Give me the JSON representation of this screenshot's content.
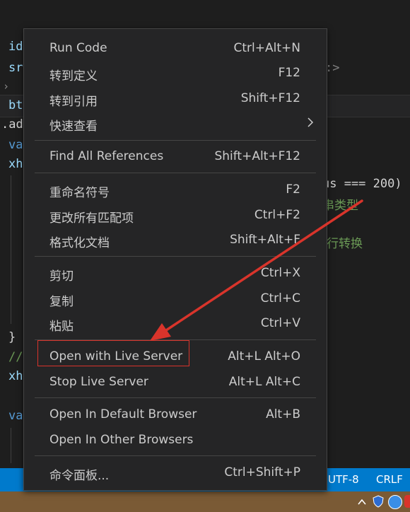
{
  "editor": {
    "fragments": [
      "id",
      "sr",
      "bt",
      ".ad",
      "va",
      "xh",
      "}",
      "//",
      "xh",
      "va"
    ],
    "right_code": {
      "status_compare": "us === 200)",
      "comment1": "串类型",
      "comment2": "行转换",
      "tag_close": ":>"
    }
  },
  "context_menu": {
    "items": [
      {
        "label": "Run Code",
        "shortcut": "Ctrl+Alt+N"
      },
      {
        "label": "转到定义",
        "shortcut": "F12"
      },
      {
        "label": "转到引用",
        "shortcut": "Shift+F12"
      },
      {
        "label": "快速查看",
        "shortcut": ""
      },
      {
        "label": "Find All References",
        "shortcut": "Shift+Alt+F12"
      },
      {
        "label": "重命名符号",
        "shortcut": "F2"
      },
      {
        "label": "更改所有匹配项",
        "shortcut": "Ctrl+F2"
      },
      {
        "label": "格式化文档",
        "shortcut": "Shift+Alt+F"
      },
      {
        "label": "剪切",
        "shortcut": "Ctrl+X"
      },
      {
        "label": "复制",
        "shortcut": "Ctrl+C"
      },
      {
        "label": "粘贴",
        "shortcut": "Ctrl+V"
      },
      {
        "label": "Open with Live Server",
        "shortcut": "Alt+L Alt+O"
      },
      {
        "label": "Stop Live Server",
        "shortcut": "Alt+L Alt+C"
      },
      {
        "label": "Open In Default Browser",
        "shortcut": "Alt+B"
      },
      {
        "label": "Open In Other Browsers",
        "shortcut": ""
      },
      {
        "label": "命令面板...",
        "shortcut": "Ctrl+Shift+P"
      }
    ]
  },
  "statusbar": {
    "encoding": "UTF-8",
    "eol": "CRLF"
  },
  "annotation": {
    "highlight_color": "#d9342b",
    "highlighted_item": "Open with Live Server"
  },
  "colors": {
    "menu_bg": "#252526",
    "menu_text": "#cccccc",
    "statusbar_bg": "#007acc",
    "editor_bg": "#1e1e1e"
  }
}
